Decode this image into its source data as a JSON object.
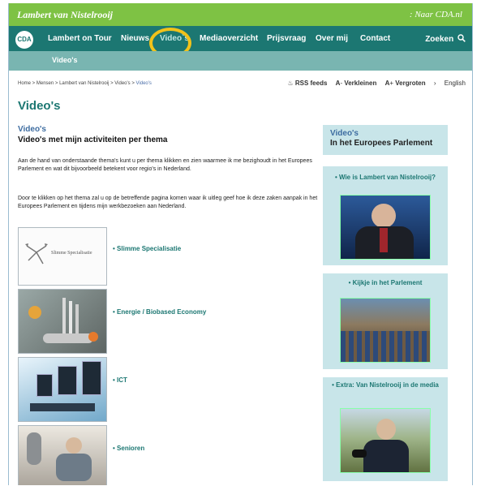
{
  "header": {
    "brand": "Lambert van Nistelrooij",
    "cda_link": ": Naar CDA.nl"
  },
  "nav": {
    "logo": "CDA",
    "items": [
      "Lambert on Tour",
      "Nieuws",
      "Video`s",
      "Mediaoverzicht",
      "Prijsvraag",
      "Over mij",
      "Contact"
    ],
    "active_index": 2,
    "search_label": "Zoeken",
    "search_icon": "search-icon"
  },
  "subnav": {
    "item": "Video's"
  },
  "breadcrumb": [
    "Home",
    "Mensen",
    "Lambert van Nistelrooij",
    "Video's",
    "Video's"
  ],
  "tools": {
    "rss": "RSS feeds",
    "smaller": "Verkleinen",
    "larger": "Vergroten",
    "english": "English"
  },
  "page_title": "Video's",
  "section": {
    "title": "Video's",
    "subtitle": "Video's met mijn activiteiten per thema",
    "para1": "Aan de hand van onderstaande thema's kunt u per thema klikken en zien waarmee ik me bezighoudt in het Europees Parlement en wat dit bijvoorbeeld betekent voor regio's in Nederland.",
    "para2": "Door te klikken op het thema zal u op de betreffende pagina komen waar ik uitleg geef hoe ik deze zaken aanpak in het Europees Parlement en tijdens mijn werkbezoeken aan Nederland."
  },
  "themes": [
    {
      "label": "Slimme Specialisatie",
      "thumb_text": "Slimme Specialisatie"
    },
    {
      "label": "Energie / Biobased Economy"
    },
    {
      "label": "ICT"
    },
    {
      "label": "Senioren"
    }
  ],
  "sidebar": {
    "head_title": "Video's",
    "head_sub": "In het Europees Parlement",
    "panels": [
      {
        "title": "Wie is Lambert van Nistelrooij?"
      },
      {
        "title": "Kijkje in het Parlement"
      },
      {
        "title": "Extra: Van Nistelrooij in de media"
      }
    ]
  },
  "colors": {
    "green": "#7ec244",
    "teal": "#1c7772",
    "subnav": "#79b5b1",
    "highlight": "#f1c21a",
    "panel": "#c8e5e9"
  }
}
